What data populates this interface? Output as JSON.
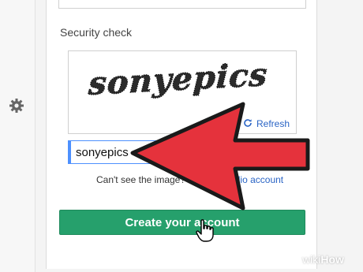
{
  "form": {
    "section_label": "Security check",
    "captcha_text": "sonyepics",
    "refresh_label": "Refresh",
    "answer_value": "sonyepics",
    "hint_text": "Can't see the image?",
    "hint_link": "Hear an audio account",
    "create_button_label": "Create your account"
  },
  "watermark": {
    "prefix": "wiki",
    "suffix": "How"
  },
  "colors": {
    "accent_green": "#26a06c",
    "arrow_red": "#e5323c",
    "link_blue": "#2a64c5"
  },
  "icons": [
    "gear-icon",
    "refresh-icon",
    "pointer-hand-icon",
    "arrow-icon"
  ]
}
